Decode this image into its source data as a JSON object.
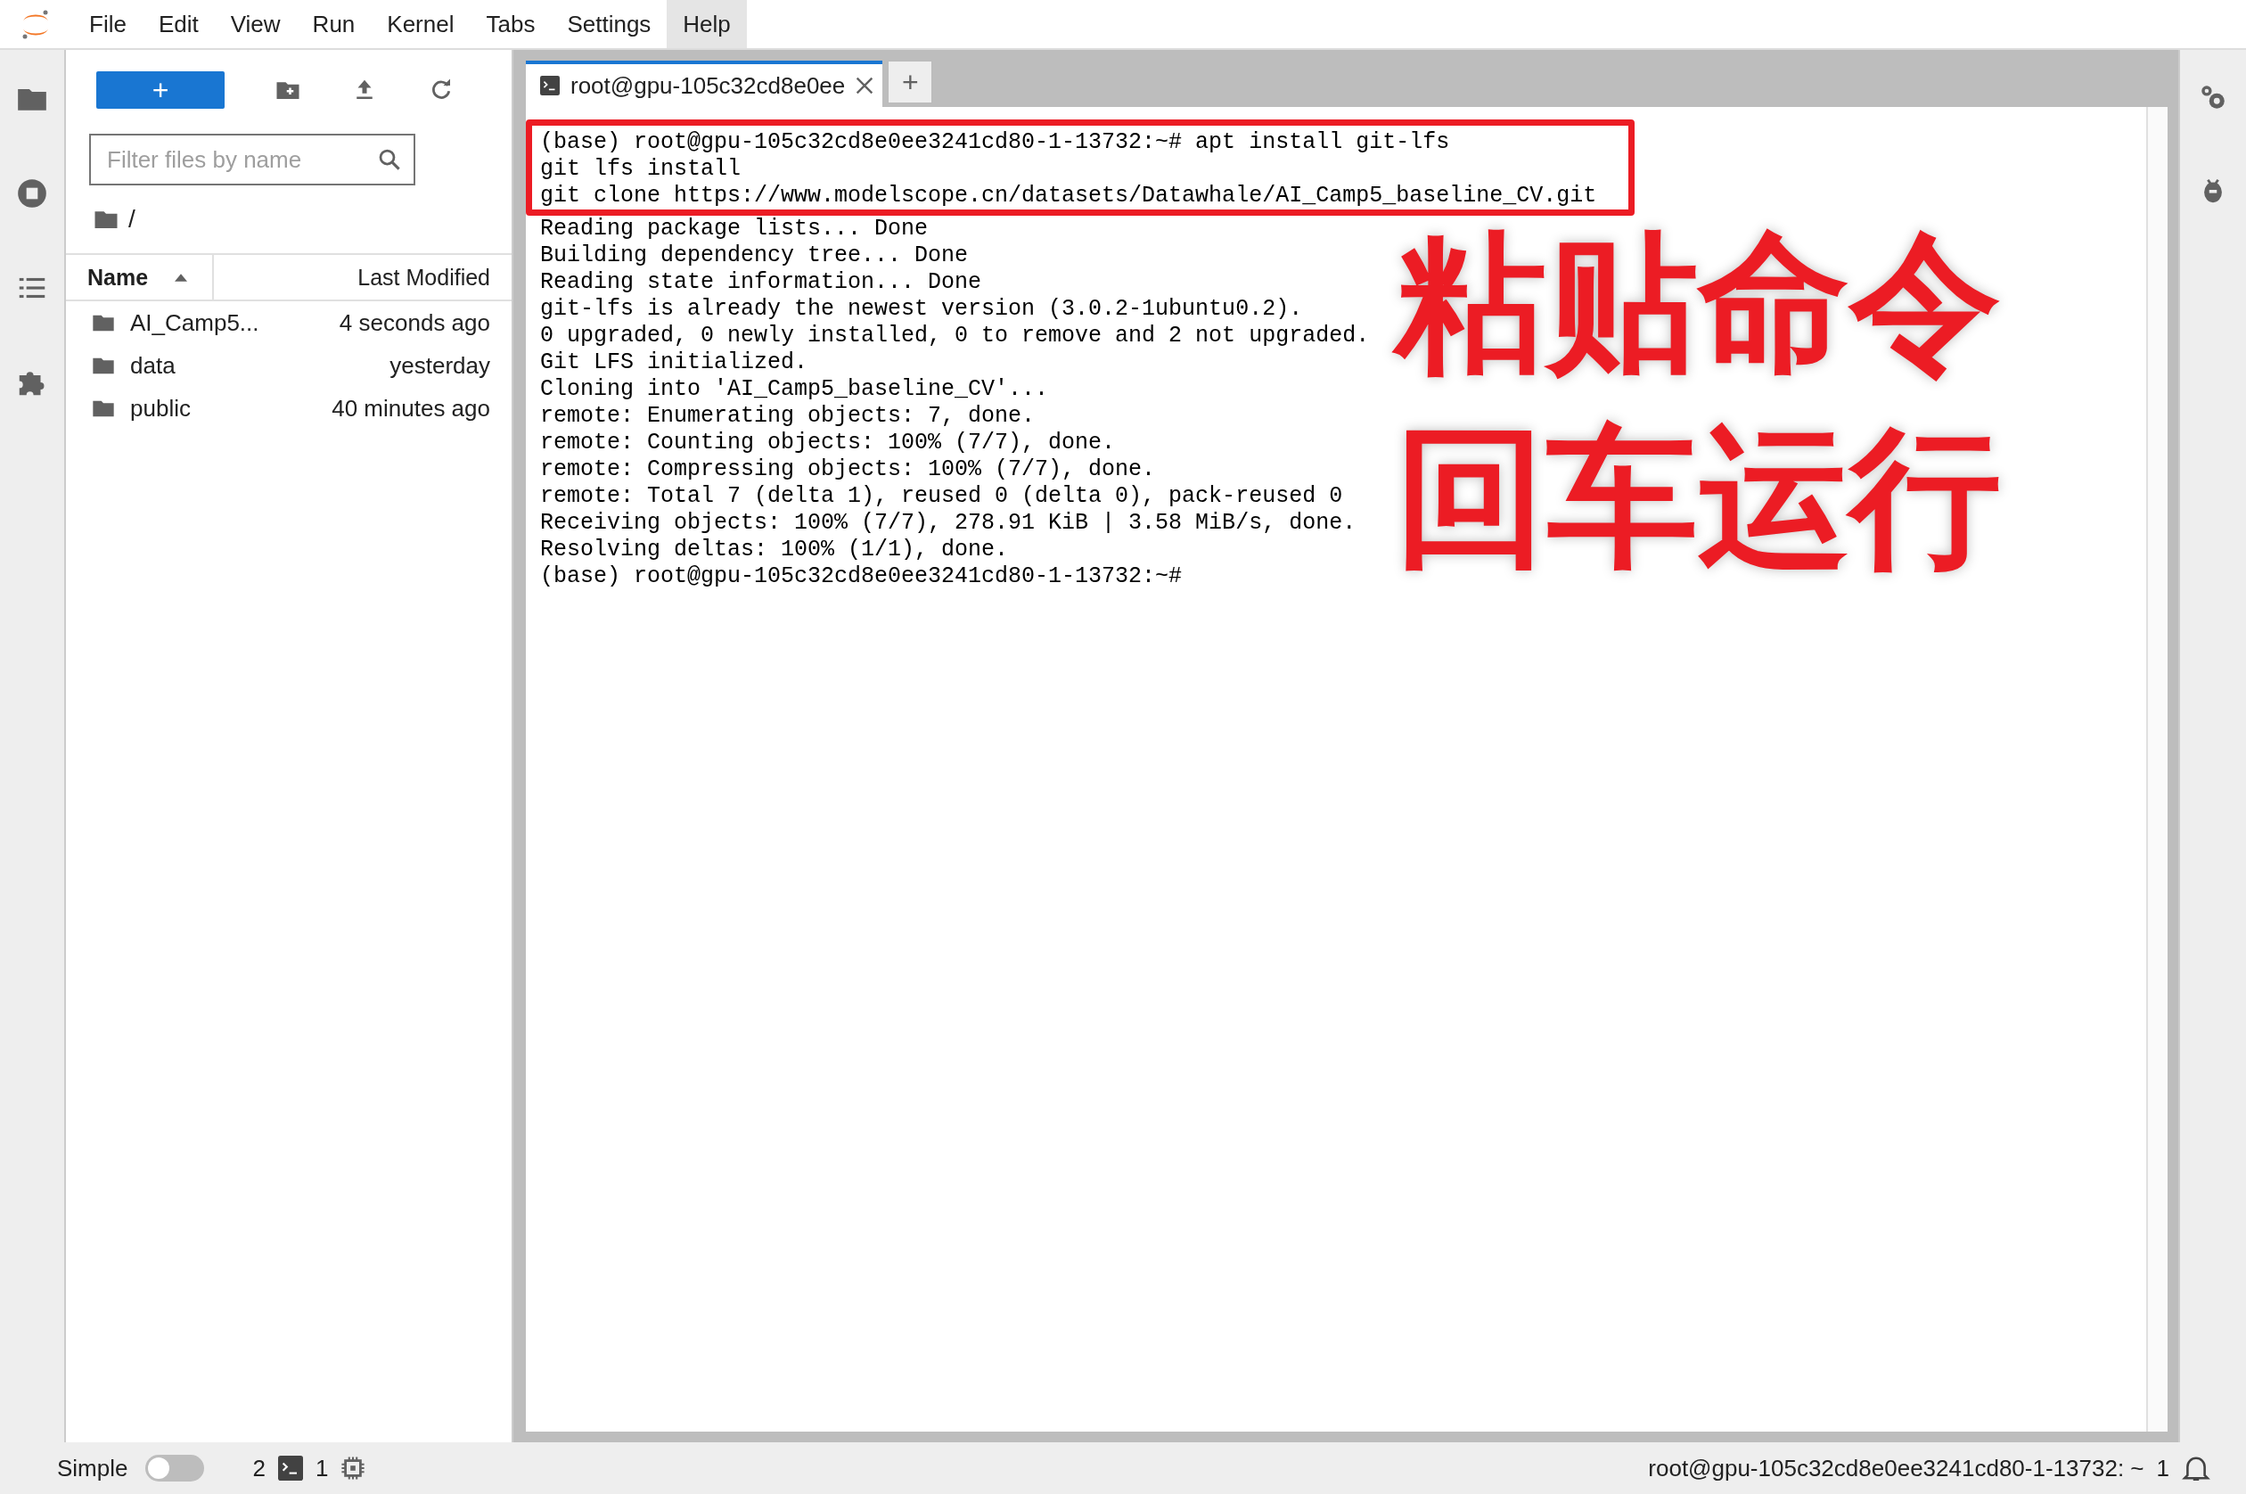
{
  "menu": [
    {
      "label": "File",
      "selected": false
    },
    {
      "label": "Edit",
      "selected": false
    },
    {
      "label": "View",
      "selected": false
    },
    {
      "label": "Run",
      "selected": false
    },
    {
      "label": "Kernel",
      "selected": false
    },
    {
      "label": "Tabs",
      "selected": false
    },
    {
      "label": "Settings",
      "selected": false
    },
    {
      "label": "Help",
      "selected": true
    }
  ],
  "launcher_button": "+",
  "filter": {
    "placeholder": "Filter files by name"
  },
  "path": "/",
  "columns": [
    "Name",
    "Last Modified"
  ],
  "files": [
    {
      "name": "AI_Camp5...",
      "modified": "4 seconds ago"
    },
    {
      "name": "data",
      "modified": "yesterday"
    },
    {
      "name": "public",
      "modified": "40 minutes ago"
    }
  ],
  "tab": {
    "title": "root@gpu-105c32cd8e0ee",
    "selected": true
  },
  "new_tab": "+",
  "pasted_lines": [
    "(base) root@gpu-105c32cd8e0ee3241cd80-1-13732:~# apt install git-lfs",
    "git lfs install",
    "git clone https://www.modelscope.cn/datasets/Datawhale/AI_Camp5_baseline_CV.git"
  ],
  "output_lines": [
    "Reading package lists... Done",
    "Building dependency tree... Done",
    "Reading state information... Done",
    "git-lfs is already the newest version (3.0.2-1ubuntu0.2).",
    "0 upgraded, 0 newly installed, 0 to remove and 2 not upgraded.",
    "Git LFS initialized.",
    "Cloning into 'AI_Camp5_baseline_CV'...",
    "remote: Enumerating objects: 7, done.",
    "remote: Counting objects: 100% (7/7), done.",
    "remote: Compressing objects: 100% (7/7), done.",
    "remote: Total 7 (delta 1), reused 0 (delta 0), pack-reused 0",
    "Receiving objects: 100% (7/7), 278.91 KiB | 3.58 MiB/s, done.",
    "Resolving deltas: 100% (1/1), done.",
    "(base) root@gpu-105c32cd8e0ee3241cd80-1-13732:~#"
  ],
  "annotations": [
    "粘贴命令",
    "回车运行"
  ],
  "status_bar": {
    "mode_label": "Simple",
    "simple_mode": false,
    "kernels": "2",
    "terminals": "1",
    "terminal_name": "root@gpu-105c32cd8e0ee3241cd80-1-13732: ~",
    "notifications": "1"
  }
}
